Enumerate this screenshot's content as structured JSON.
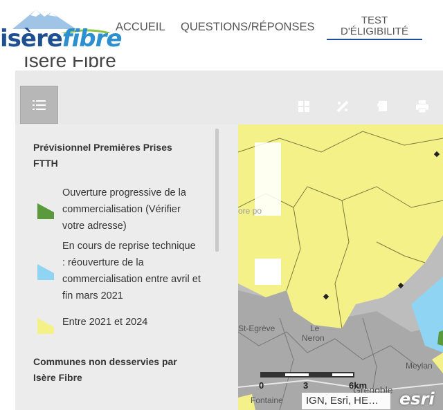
{
  "header": {
    "logo_isere": "isère",
    "logo_fibre": "fibre",
    "nav": [
      {
        "label": "ACCUEIL"
      },
      {
        "label": "QUESTIONS/RÉPONSES"
      }
    ],
    "test_line1": "TEST",
    "test_line2": "D'ÉLIGIBILITÉ"
  },
  "page": {
    "title": "Isère Fibre"
  },
  "toolbar": {
    "icons": [
      "basemap-gallery-icon",
      "measure-icon",
      "layer-list-icon",
      "print-icon"
    ]
  },
  "legend": {
    "heading1": "Prévisionnel Premières Prises FTTH",
    "items": [
      {
        "label": "Ouverture progressive de la commercialisation (Vérifier votre adresse)",
        "color": "#5a9a3c"
      },
      {
        "label": "En cours de reprise technique : réouverture de la commercialisation entre avril et fin mars 2021",
        "color": "#8fd4f2"
      },
      {
        "label": "Entre 2021 et 2024",
        "color": "#f4f188"
      }
    ],
    "heading2": "Communes non desservies par Isère Fibre"
  },
  "map": {
    "attribution": "IGN, Esri, HE…",
    "esri_logo": "esri",
    "scale": {
      "zero": "0",
      "mid": "3",
      "end": "6km"
    },
    "labels": [
      "St-Egrève",
      "Le",
      "Neron",
      "Meylan",
      "Grenoble",
      "Fontaine",
      "ore po"
    ]
  },
  "colors": {
    "accent": "#1d4f91",
    "yellow_zone": "#f4f188",
    "blue_zone": "#8fd4f2",
    "green_zone": "#5a9a3c"
  }
}
